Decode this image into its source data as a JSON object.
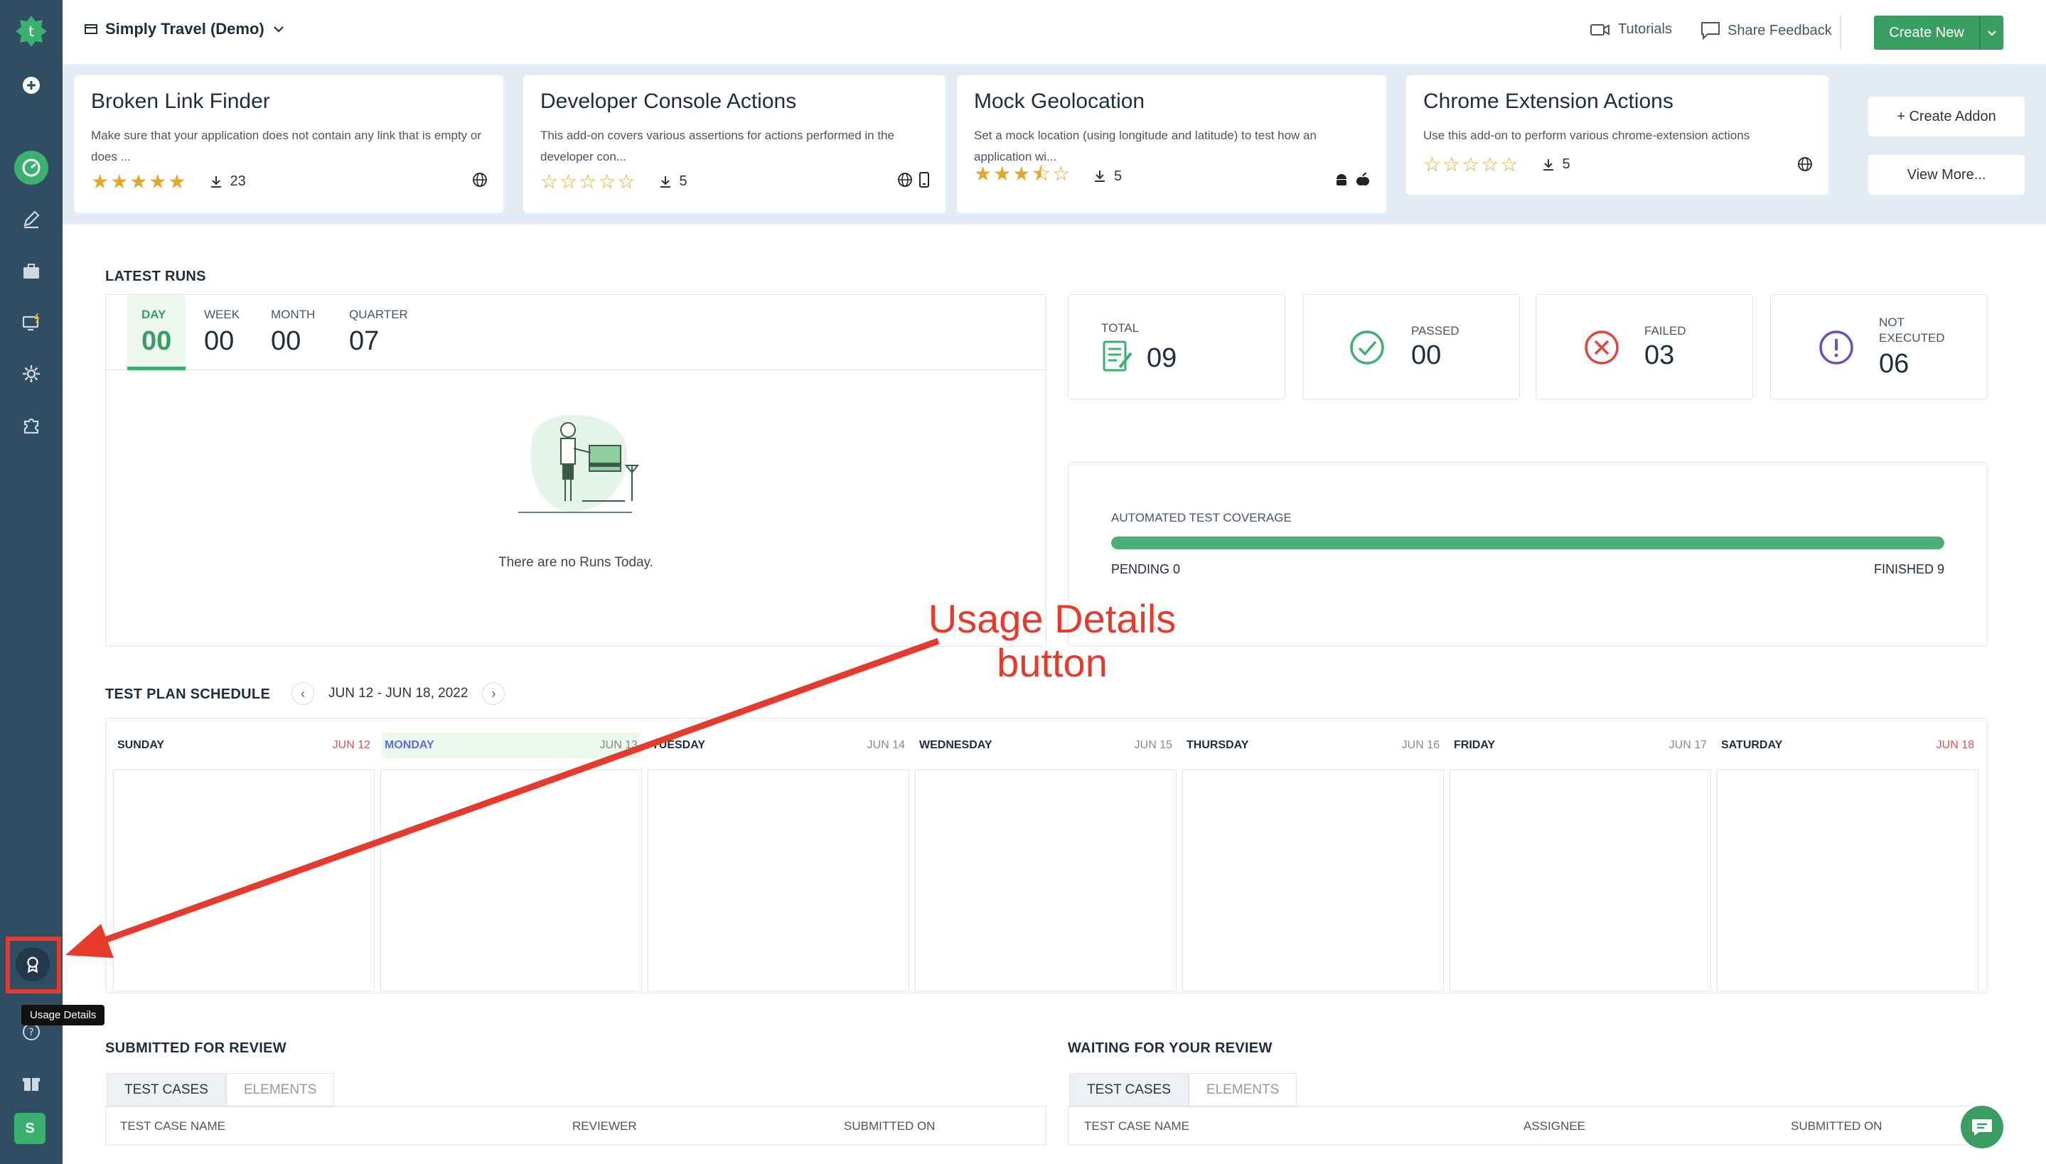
{
  "header": {
    "project": "Simply Travel (Demo)",
    "tutorials": "Tutorials",
    "feedback": "Share Feedback",
    "create_new": "Create New"
  },
  "addons": [
    {
      "title": "Broken Link Finder",
      "desc": "Make sure that your application does not contain any link that is empty or does ...",
      "stars": "★★★★★",
      "rating": 5,
      "downloads": "23",
      "platforms": "globe"
    },
    {
      "title": "Developer Console Actions",
      "desc": "This add-on covers various assertions for actions performed in the developer con...",
      "stars": "☆☆☆☆☆",
      "rating": 0,
      "downloads": "5",
      "platforms": "globe, mobile"
    },
    {
      "title": "Mock Geolocation",
      "desc": "Set a mock location (using longitude and latitude) to test how an application wi...",
      "stars": "★★★⯪☆",
      "rating": 3.5,
      "downloads": "5",
      "platforms": "android, apple"
    },
    {
      "title": "Chrome Extension Actions",
      "desc": "Use this add-on to perform various chrome-extension actions",
      "stars": "☆☆☆☆☆",
      "rating": 0,
      "downloads": "5",
      "platforms": "globe"
    }
  ],
  "addon_buttons": {
    "create": "+ Create Addon",
    "more": "View More..."
  },
  "latest_runs": {
    "title": "LATEST RUNS",
    "tabs": [
      {
        "label": "DAY",
        "value": "00"
      },
      {
        "label": "WEEK",
        "value": "00"
      },
      {
        "label": "MONTH",
        "value": "00"
      },
      {
        "label": "QUARTER",
        "value": "07"
      }
    ],
    "empty": "There are no Runs Today."
  },
  "stats": {
    "total": {
      "label": "TOTAL",
      "value": "09"
    },
    "passed": {
      "label": "PASSED",
      "value": "00"
    },
    "failed": {
      "label": "FAILED",
      "value": "03"
    },
    "not_executed": {
      "label1": "NOT",
      "label2": "EXECUTED",
      "value": "06"
    }
  },
  "coverage": {
    "title": "AUTOMATED TEST COVERAGE",
    "pending": "PENDING 0",
    "finished": "FINISHED 9",
    "fill_percent": 100
  },
  "schedule": {
    "title": "TEST PLAN SCHEDULE",
    "range": "JUN 12 - JUN 18, 2022",
    "days": [
      {
        "name": "SUNDAY",
        "date": "JUN 12"
      },
      {
        "name": "MONDAY",
        "date": "JUN 13"
      },
      {
        "name": "TUESDAY",
        "date": "JUN 14"
      },
      {
        "name": "WEDNESDAY",
        "date": "JUN 15"
      },
      {
        "name": "THURSDAY",
        "date": "JUN 16"
      },
      {
        "name": "FRIDAY",
        "date": "JUN 17"
      },
      {
        "name": "SATURDAY",
        "date": "JUN 18"
      }
    ]
  },
  "submitted": {
    "title": "SUBMITTED FOR REVIEW",
    "tab1": "TEST CASES",
    "tab2": "ELEMENTS",
    "col1": "TEST CASE NAME",
    "col2": "REVIEWER",
    "col3": "SUBMITTED ON"
  },
  "waiting": {
    "title": "WAITING FOR YOUR REVIEW",
    "tab1": "TEST CASES",
    "tab2": "ELEMENTS",
    "col1": "TEST CASE NAME",
    "col2": "ASSIGNEE",
    "col3": "SUBMITTED ON"
  },
  "sidebar": {
    "tooltip": "Usage Details",
    "avatar": "S"
  },
  "annotation": {
    "line1": "Usage Details",
    "line2": "button"
  },
  "colors": {
    "sidebar": "#2f4d63",
    "accent": "#3bb06f",
    "annotation": "#e53b2c"
  }
}
